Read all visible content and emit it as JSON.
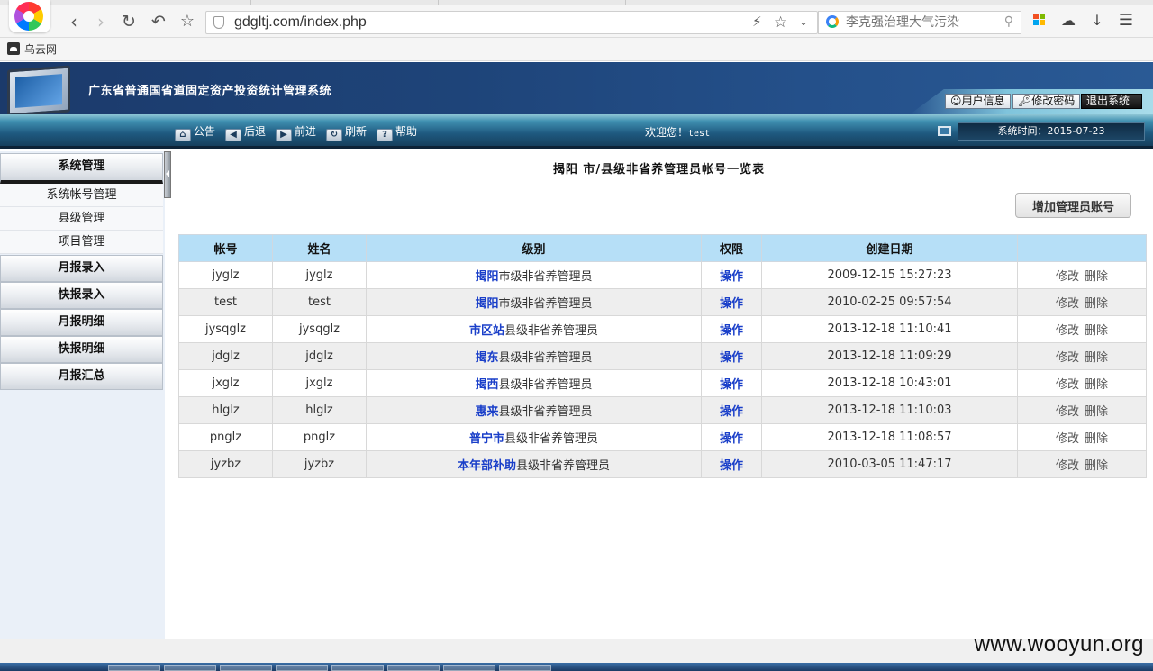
{
  "browser": {
    "url": "gdgltj.com/index.php",
    "search_placeholder": "李克强治理大气污染",
    "bookmark_label": "乌云网"
  },
  "header": {
    "system_title": "广东省普通国省道固定资产投资统计管理系统",
    "btn_user_info": "用户信息",
    "btn_change_password": "修改密码",
    "btn_logout": "退出系统"
  },
  "toolbar": {
    "notice": "公告",
    "back": "后退",
    "forward": "前进",
    "refresh": "刷新",
    "help": "帮助",
    "welcome": "欢迎您！",
    "username": "test",
    "system_time": "系统时间：2015-07-23"
  },
  "sidebar": {
    "system_management": "系统管理",
    "sub_items": [
      "系统帐号管理",
      "县级管理",
      "项目管理"
    ],
    "sections": [
      "月报录入",
      "快报录入",
      "月报明细",
      "快报明细",
      "月报汇总"
    ]
  },
  "main": {
    "title": "揭阳 市/县级非省养管理员帐号一览表",
    "add_button": "增加管理员账号",
    "columns": [
      "帐号",
      "姓名",
      "级别",
      "权限",
      "创建日期",
      ""
    ],
    "rows": [
      {
        "account": "jyglz",
        "name": "jyglz",
        "level_link": "揭阳",
        "level_suffix": "市级非省养管理员",
        "permission": "操作",
        "created": "2009-12-15 15:27:23"
      },
      {
        "account": "test",
        "name": "test",
        "level_link": "揭阳",
        "level_suffix": "市级非省养管理员",
        "permission": "操作",
        "created": "2010-02-25 09:57:54"
      },
      {
        "account": "jysqglz",
        "name": "jysqglz",
        "level_link": "市区站",
        "level_suffix": "县级非省养管理员",
        "permission": "操作",
        "created": "2013-12-18 11:10:41"
      },
      {
        "account": "jdglz",
        "name": "jdglz",
        "level_link": "揭东",
        "level_suffix": "县级非省养管理员",
        "permission": "操作",
        "created": "2013-12-18 11:09:29"
      },
      {
        "account": "jxglz",
        "name": "jxglz",
        "level_link": "揭西",
        "level_suffix": "县级非省养管理员",
        "permission": "操作",
        "created": "2013-12-18 10:43:01"
      },
      {
        "account": "hlglz",
        "name": "hlglz",
        "level_link": "惠来",
        "level_suffix": "县级非省养管理员",
        "permission": "操作",
        "created": "2013-12-18 11:10:03"
      },
      {
        "account": "pnglz",
        "name": "pnglz",
        "level_link": "普宁市",
        "level_suffix": "县级非省养管理员",
        "permission": "操作",
        "created": "2013-12-18 11:08:57"
      },
      {
        "account": "jyzbz",
        "name": "jyzbz",
        "level_link": "本年部补助",
        "level_suffix": "县级非省养管理员",
        "permission": "操作",
        "created": "2010-03-05 11:47:17"
      }
    ],
    "row_action_edit": "修改",
    "row_action_delete": "删除"
  },
  "watermark": "www.wooyun.org"
}
